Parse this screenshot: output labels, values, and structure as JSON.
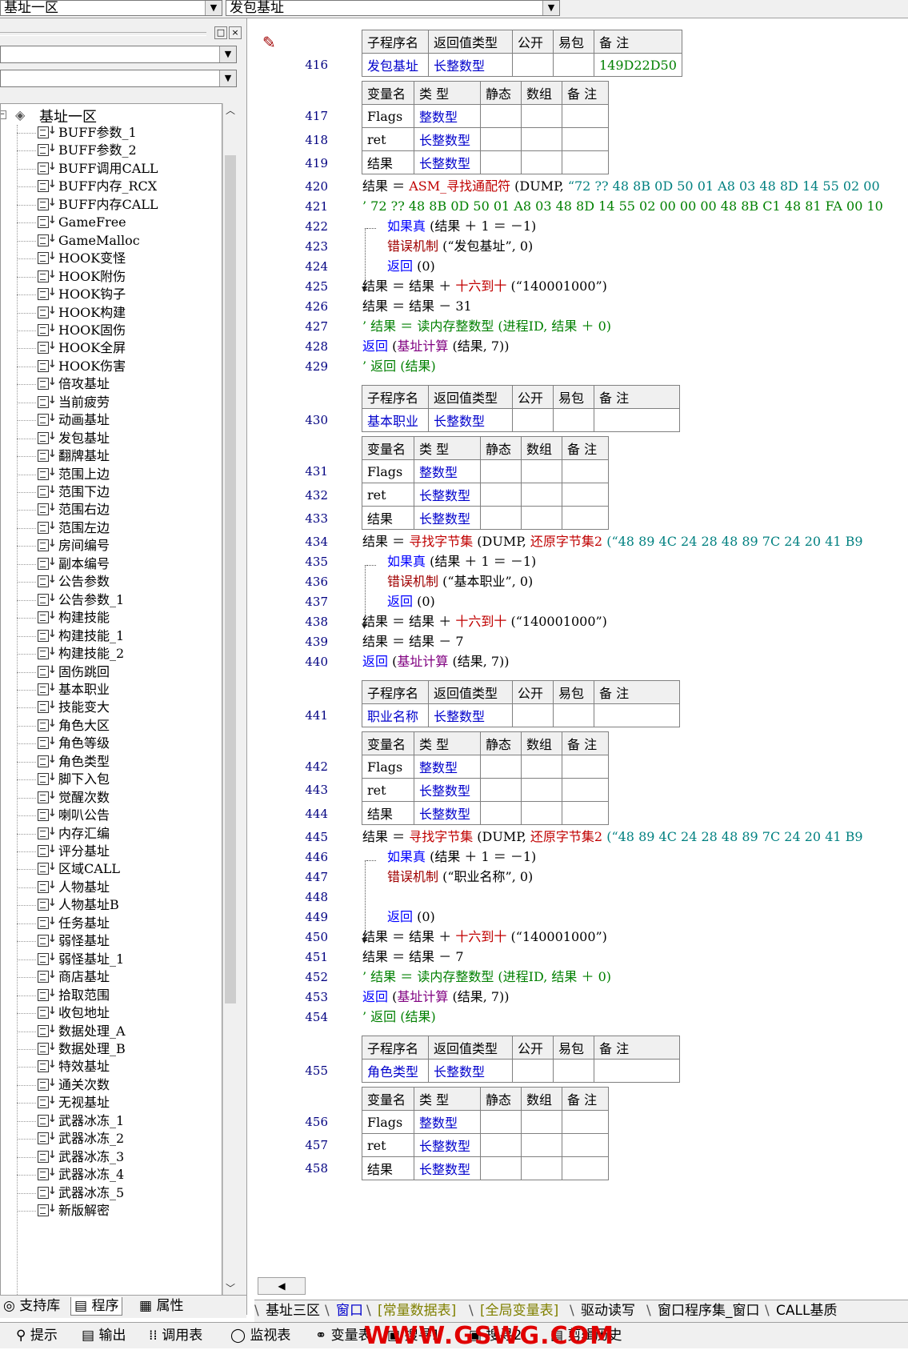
{
  "topbar": {
    "left_combo": "基址一区",
    "right_combo": "发包基址"
  },
  "left_panel": {
    "pin_icon": "□",
    "close_icon": "×",
    "tree": {
      "root_label": "基址一区",
      "items": [
        "BUFF参数_1",
        "BUFF参数_2",
        "BUFF调用CALL",
        "BUFF内存_RCX",
        "BUFF内存CALL",
        "GameFree",
        "GameMalloc",
        "HOOK变怪",
        "HOOK附伤",
        "HOOK钩子",
        "HOOK构建",
        "HOOK固伤",
        "HOOK全屏",
        "HOOK伤害",
        "倍攻基址",
        "当前疲劳",
        "动画基址",
        "发包基址",
        "翻牌基址",
        "范围上边",
        "范围下边",
        "范围右边",
        "范围左边",
        "房间编号",
        "副本编号",
        "公告参数",
        "公告参数_1",
        "构建技能",
        "构建技能_1",
        "构建技能_2",
        "固伤跳回",
        "基本职业",
        "技能变大",
        "角色大区",
        "角色等级",
        "角色类型",
        "脚下入包",
        "觉醒次数",
        "喇叭公告",
        "内存汇编",
        "评分基址",
        "区域CALL",
        "人物基址",
        "人物基址B",
        "任务基址",
        "弱怪基址",
        "弱怪基址_1",
        "商店基址",
        "拾取范围",
        "收包地址",
        "数据处理_A",
        "数据处理_B",
        "特效基址",
        "通关次数",
        "无视基址",
        "武器冰冻_1",
        "武器冰冻_2",
        "武器冰冻_3",
        "武器冰冻_4",
        "武器冰冻_5",
        "新版解密"
      ],
      "selected": "发包基址"
    },
    "tabs": [
      "支持库",
      "程序",
      "属性"
    ]
  },
  "code": {
    "sub_header": [
      "子程序名",
      "返回值类型",
      "公开",
      "易包",
      "备 注"
    ],
    "var_header": [
      "变量名",
      "类 型",
      "静态",
      "数组",
      "备 注"
    ],
    "block1": {
      "sub_line": "416",
      "sub_name": "发包基址",
      "sub_type": "长整数型",
      "sub_note": "149D22D50",
      "vars": [
        {
          "ln": "417",
          "name": "Flags",
          "type": "整数型"
        },
        {
          "ln": "418",
          "name": "ret",
          "type": "长整数型"
        },
        {
          "ln": "419",
          "name": "结果",
          "type": "长整数型"
        }
      ]
    },
    "block2": {
      "sub_line": "430",
      "sub_name": "基本职业",
      "sub_type": "长整数型",
      "vars": [
        {
          "ln": "431",
          "name": "Flags",
          "type": "整数型"
        },
        {
          "ln": "432",
          "name": "ret",
          "type": "长整数型"
        },
        {
          "ln": "433",
          "name": "结果",
          "type": "长整数型"
        }
      ]
    },
    "block3": {
      "sub_line": "441",
      "sub_name": "职业名称",
      "sub_type": "长整数型",
      "vars": [
        {
          "ln": "442",
          "name": "Flags",
          "type": "整数型"
        },
        {
          "ln": "443",
          "name": "ret",
          "type": "长整数型"
        },
        {
          "ln": "444",
          "name": "结果",
          "type": "长整数型"
        }
      ]
    },
    "block4": {
      "sub_line": "455",
      "sub_name": "角色类型",
      "sub_type": "长整数型",
      "vars": [
        {
          "ln": "456",
          "name": "Flags",
          "type": "整数型"
        },
        {
          "ln": "457",
          "name": "ret",
          "type": "长整数型"
        },
        {
          "ln": "458",
          "name": "结果",
          "type": "长整数型"
        }
      ]
    },
    "lines": {
      "l420": {
        "ln": "420",
        "a": "结果 ＝ ",
        "b": "ASM_寻找通配符",
        "c": " (DUMP, ",
        "d": "“72 ?? 48 8B 0D 50 01 A8 03 48 8D 14 55 02 00"
      },
      "l421": {
        "ln": "421",
        "a": "’ 72 ?? 48 8B 0D 50 01 A8 03 48 8D 14 55 02 00 00 00 48 8B C1 48 81 FA 00 10"
      },
      "l422": {
        "ln": "422",
        "a": "如果真",
        "b": " (结果 ＋ 1 ＝ －1)"
      },
      "l423": {
        "ln": "423",
        "a": "错误机制",
        "b": " (“发包基址”, 0)"
      },
      "l424": {
        "ln": "424",
        "a": "返回",
        "b": " (0)"
      },
      "l425": {
        "ln": "425",
        "a": "结果 ＝ 结果 ＋ ",
        "b": "十六到十",
        "c": " (“140001000”)"
      },
      "l426": {
        "ln": "426",
        "a": "结果 ＝ 结果 － 31"
      },
      "l427": {
        "ln": "427",
        "a": "’ 结果 ＝ 读内存整数型 (进程ID, 结果 ＋ 0)"
      },
      "l428": {
        "ln": "428",
        "a": "返回",
        "b": " (",
        "c": "基址计算",
        "d": " (结果, 7))"
      },
      "l429": {
        "ln": "429",
        "a": "’ 返回 (结果)"
      },
      "l434": {
        "ln": "434",
        "a": "结果 ＝ ",
        "b": "寻找字节集",
        "c": " (DUMP, ",
        "d": "还原字节集2",
        "e": " (“48 89 4C 24 28 48 89 7C 24 20 41 B9"
      },
      "l435": {
        "ln": "435",
        "a": "如果真",
        "b": " (结果 ＋ 1 ＝ －1)"
      },
      "l436": {
        "ln": "436",
        "a": "错误机制",
        "b": " (“基本职业”, 0)"
      },
      "l437": {
        "ln": "437",
        "a": "返回",
        "b": " (0)"
      },
      "l438": {
        "ln": "438",
        "a": "结果 ＝ 结果 ＋ ",
        "b": "十六到十",
        "c": " (“140001000”)"
      },
      "l439": {
        "ln": "439",
        "a": "结果 ＝ 结果 － 7"
      },
      "l440": {
        "ln": "440",
        "a": "返回",
        "b": " (",
        "c": "基址计算",
        "d": " (结果, 7))"
      },
      "l445": {
        "ln": "445",
        "a": "结果 ＝ ",
        "b": "寻找字节集",
        "c": " (DUMP, ",
        "d": "还原字节集2",
        "e": " (“48 89 4C 24 28 48 89 7C 24 20 41 B9"
      },
      "l446": {
        "ln": "446",
        "a": "如果真",
        "b": " (结果 ＋ 1 ＝ －1)"
      },
      "l447": {
        "ln": "447",
        "a": "错误机制",
        "b": " (“职业名称”, 0)"
      },
      "l448": {
        "ln": "448"
      },
      "l449": {
        "ln": "449",
        "a": "返回",
        "b": " (0)"
      },
      "l450": {
        "ln": "450",
        "a": "结果 ＝ 结果 ＋ ",
        "b": "十六到十",
        "c": " (“140001000”)"
      },
      "l451": {
        "ln": "451",
        "a": "结果 ＝ 结果 － 7"
      },
      "l452": {
        "ln": "452",
        "a": "’ 结果 ＝ 读内存整数型 (进程ID, 结果 ＋ 0)"
      },
      "l453": {
        "ln": "453",
        "a": "返回",
        "b": " (",
        "c": "基址计算",
        "d": " (结果, 7))"
      },
      "l454": {
        "ln": "454",
        "a": "’ 返回 (结果)"
      }
    }
  },
  "code_tabs": [
    "基址三区",
    "窗口",
    "[常量数据表]",
    "[全局变量表]",
    "驱动读写",
    "窗口程序集_窗口",
    "CALL基质"
  ],
  "bottom_tabs": [
    "提示",
    "输出",
    "调用表",
    "监视表",
    "变量表",
    "搜寻1",
    "搜寻2",
    "剪辑历史"
  ],
  "watermark": "WWW.GSWG.COM"
}
